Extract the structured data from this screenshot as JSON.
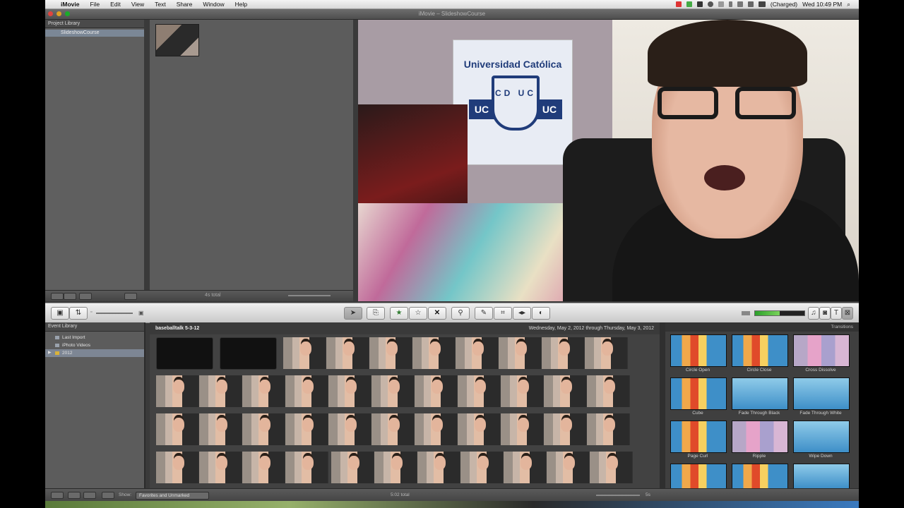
{
  "menubar": {
    "app": "iMovie",
    "items": [
      "File",
      "Edit",
      "View",
      "Text",
      "Share",
      "Window",
      "Help"
    ],
    "status": "(Charged)",
    "clock": "Wed 10:49 PM"
  },
  "window": {
    "title": "iMovie – SlideshowCourse"
  },
  "project_library": {
    "header": "Project Library",
    "item": "SlideshowCourse",
    "total": "4s total"
  },
  "viewer": {
    "flag_text": "Universidad Católica",
    "uc_left": "UC",
    "uc_right": "UC",
    "shield_text": "CD UC"
  },
  "event_library": {
    "header": "Event Library",
    "items": [
      {
        "label": "Last Import"
      },
      {
        "label": "iPhoto Videos"
      },
      {
        "label": "2012"
      }
    ]
  },
  "event_browser": {
    "event_name": "baseballtalk 5-3-12",
    "date_range": "Wednesday, May 2, 2012 through Thursday, May 3, 2012"
  },
  "transitions": {
    "header": "Transitions",
    "items": [
      {
        "label": "Circle Open"
      },
      {
        "label": "Circle Close"
      },
      {
        "label": "Cross Dissolve"
      },
      {
        "label": "Cube"
      },
      {
        "label": "Fade Through Black"
      },
      {
        "label": "Fade Through White"
      },
      {
        "label": "Page Curl"
      },
      {
        "label": "Ripple"
      },
      {
        "label": "Wipe Down"
      }
    ]
  },
  "bottom_bar": {
    "show_label": "Show:",
    "show_value": "Favorites and Unmarked",
    "total": "5:02 total",
    "zoom": "5s"
  },
  "colors": {
    "accent_green": "#2ca02c",
    "selection": "#7d8694"
  }
}
